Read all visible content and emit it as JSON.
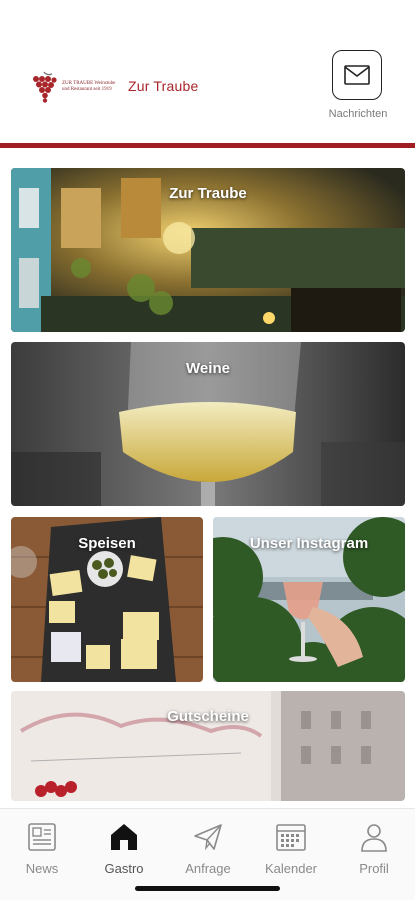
{
  "header": {
    "logo_small_text": "ZUR TRAUBE Weinstube und Restaurant seit 1919",
    "logo_title": "Zur Traube",
    "messages_label": "Nachrichten"
  },
  "tiles": [
    {
      "label": "Zur Traube"
    },
    {
      "label": "Weine"
    },
    {
      "label": "Speisen"
    },
    {
      "label": "Unser Instagram"
    },
    {
      "label": "Gutscheine"
    }
  ],
  "nav": {
    "news": "News",
    "gastro": "Gastro",
    "anfrage": "Anfrage",
    "kalender": "Kalender",
    "profil": "Profil"
  },
  "colors": {
    "brand_red": "#a01d22",
    "nav_inactive": "#8a8a8a",
    "nav_active": "#111111"
  }
}
